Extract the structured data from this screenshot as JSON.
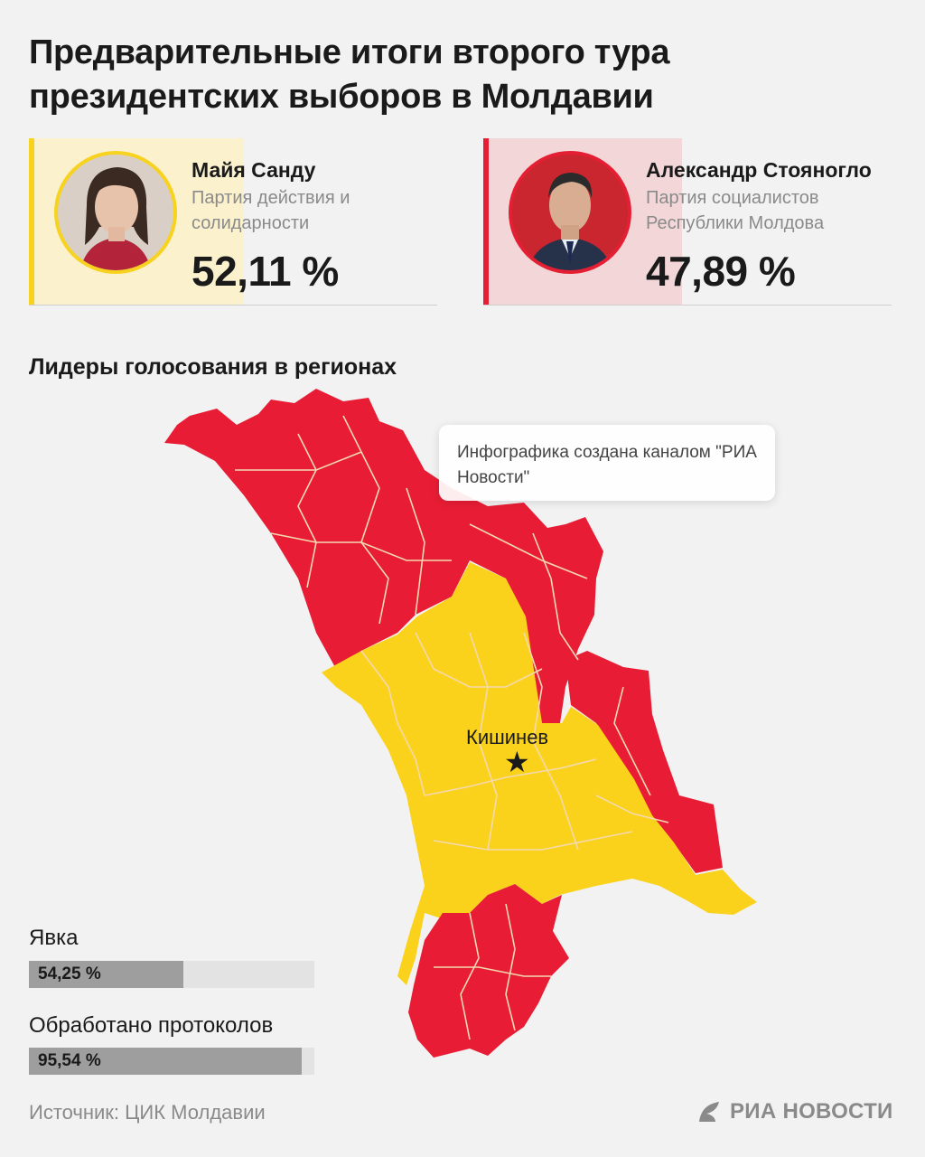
{
  "header": {
    "title": "Предварительные итоги второго тура президентских выборов в Молдавии"
  },
  "candidates": [
    {
      "name": "Майя Санду",
      "party": "Партия действия и солидарности",
      "percent": "52,11 %",
      "share": 52.11,
      "color": "#f7d21e",
      "fill_color": "#fbf1cc"
    },
    {
      "name": "Александр Стояногло",
      "party": "Партия социалистов Республики Молдова",
      "percent": "47,89 %",
      "share": 47.89,
      "color": "#e41f33",
      "fill_color": "#f3d6d8"
    }
  ],
  "map": {
    "title": "Лидеры голосования в регионах",
    "city": "Кишинев",
    "note": "Инфографика создана каналом \"РИА Новости\"",
    "colors": {
      "sandu": "#fbd21b",
      "stoianoglo": "#e81d35",
      "borders": "#f3d9b0"
    }
  },
  "stats": {
    "turnout": {
      "label": "Явка",
      "value": "54,25 %",
      "fraction": 0.5425
    },
    "processed": {
      "label": "Обработано протоколов",
      "value": "95,54 %",
      "fraction": 0.9554
    }
  },
  "footer": {
    "source": "Источник: ЦИК Молдавии",
    "brand": "РИА НОВОСТИ"
  }
}
